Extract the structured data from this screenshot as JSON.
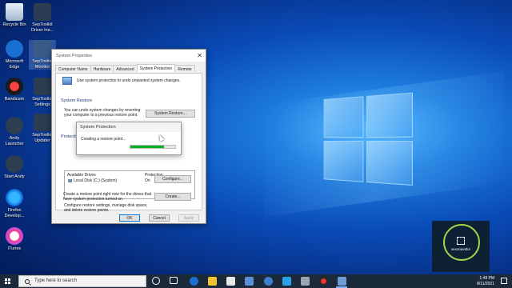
{
  "desktop": {
    "icons": [
      {
        "label": "Recycle Bin"
      },
      {
        "label": "SepToolkit Driver Ins..."
      },
      {
        "label": "Microsoft Edge"
      },
      {
        "label": "SepToolkit Monitor"
      },
      {
        "label": "Bandicam"
      },
      {
        "label": "SepToolkit Settings"
      },
      {
        "label": "Andy Launcher"
      },
      {
        "label": "SepToolkit Updater"
      },
      {
        "label": "Start Andy"
      },
      {
        "label": "Firefox Develop..."
      },
      {
        "label": "iTunes"
      }
    ]
  },
  "dialog": {
    "title": "System Properties",
    "tabs": [
      "Computer Name",
      "Hardware",
      "Advanced",
      "System Protection",
      "Remote"
    ],
    "active_tab": "System Protection",
    "intro": "Use system protection to undo unwanted system changes.",
    "restore_group": "System Restore",
    "restore_text_1": "You can undo system changes by reverting",
    "restore_text_2": "your computer to a previous restore point.",
    "restore_button": "System Restore...",
    "protection_group": "Protection Settings",
    "list_header_1": "Available Drives",
    "list_header_2": "Protection",
    "drive_name": "Local Disk (C:) (System)",
    "drive_state": "On",
    "configure_text_1": "Configure restore settings, manage disk space,",
    "configure_text_2": "and delete restore points.",
    "configure_button": "Configure...",
    "create_text_1": "Create a restore point right now for the drives that",
    "create_text_2": "have system protection turned on.",
    "create_button": "Create...",
    "ok": "OK",
    "cancel": "Cancel",
    "apply": "Apply"
  },
  "popup": {
    "title": "System Protection",
    "message": "Creating a restore point...",
    "progress": 0.75
  },
  "watermark": {
    "text": "sexonavidor"
  },
  "taskbar": {
    "search_placeholder": "Type here to search",
    "time": "1:49 PM",
    "date": "8/11/2021"
  },
  "colors": {
    "accent": "#0078d7",
    "progress": "#06b025"
  }
}
